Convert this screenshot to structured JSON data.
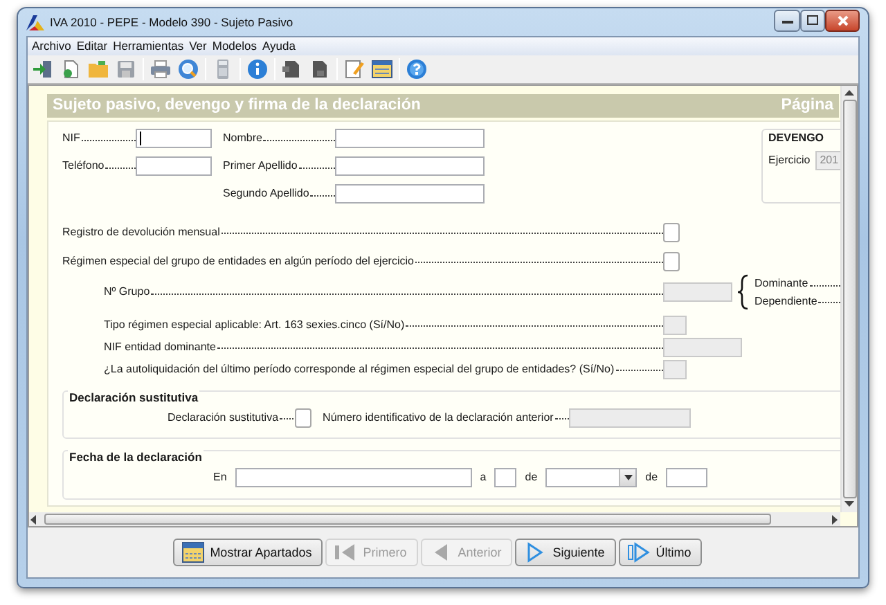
{
  "window": {
    "title": "IVA 2010 - PEPE - Modelo 390 - Sujeto Pasivo"
  },
  "menu": [
    "Archivo",
    "Editar",
    "Herramientas",
    "Ver",
    "Modelos",
    "Ayuda"
  ],
  "section": {
    "title": "Sujeto pasivo, devengo y firma de la declaración",
    "page_label": "Página"
  },
  "left_fields": [
    {
      "label": "NIF",
      "focused": true
    },
    {
      "label": "Teléfono",
      "focused": false
    }
  ],
  "right_fields": [
    {
      "label": "Nombre",
      "focused": false
    },
    {
      "label": "Primer Apellido",
      "focused": false
    },
    {
      "label": "Segundo Apellido",
      "focused": false
    }
  ],
  "devengo": {
    "title": "DEVENGO",
    "label": "Ejercicio",
    "value": "201"
  },
  "questions": [
    {
      "label": "Registro de devolución mensual",
      "kind": "checkbox",
      "disabled": false
    },
    {
      "label": "Régimen especial del grupo de entidades en algún período del ejercicio",
      "kind": "checkbox",
      "disabled": false,
      "children": [
        {
          "label": "Nº Grupo",
          "kind": "number",
          "disabled": true,
          "options": [
            "Dominante",
            "Dependiente"
          ]
        },
        {
          "label": "Tipo régimen especial aplicable: Art. 163 sexies.cinco (Sí/No)",
          "kind": "flag",
          "disabled": true
        },
        {
          "label": "NIF entidad dominante",
          "kind": "nif",
          "disabled": true
        },
        {
          "label": "¿La autoliquidación del último período corresponde al régimen especial del grupo de entidades? (Sí/No)",
          "kind": "flag",
          "disabled": true
        }
      ]
    }
  ],
  "substitute": {
    "title": "Declaración sustitutiva",
    "checkbox_label": "Declaración sustitutiva",
    "checkbox_checked": false,
    "number_label": "Número identificativo de la declaración anterior",
    "number_disabled": true
  },
  "date": {
    "title": "Fecha de la declaración",
    "parts": [
      {
        "label": "En",
        "kind": "place"
      },
      {
        "label": "a",
        "kind": "day"
      },
      {
        "label": "de",
        "kind": "month"
      },
      {
        "label": "de",
        "kind": "year"
      }
    ]
  },
  "buttons": [
    {
      "label": "Mostrar Apartados",
      "kind": "sections",
      "disabled": false
    },
    {
      "label": "Primero",
      "kind": "first",
      "disabled": true
    },
    {
      "label": "Anterior",
      "kind": "prev",
      "disabled": true
    },
    {
      "label": "Siguiente",
      "kind": "next",
      "disabled": false
    },
    {
      "label": "Último",
      "kind": "last",
      "disabled": false
    }
  ]
}
